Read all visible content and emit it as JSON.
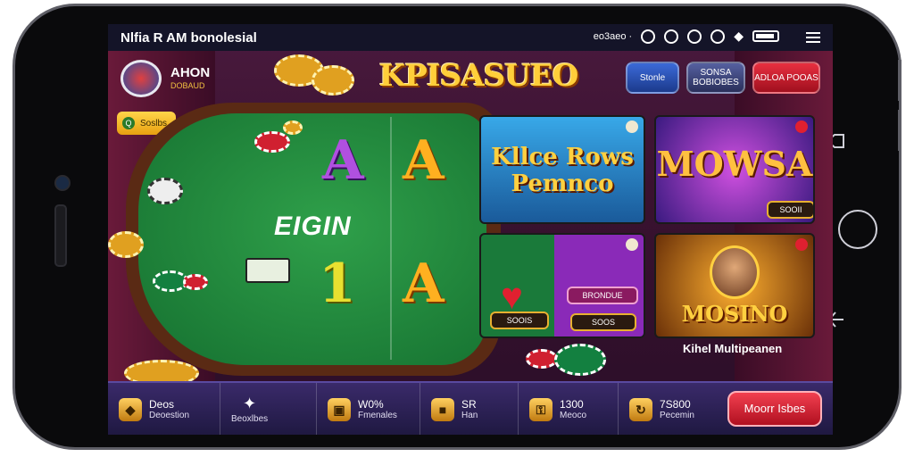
{
  "status": {
    "title": "Nlfia R AM bonolesial",
    "right_text": "eo3aeo ·",
    "icons": [
      "wifi-icon",
      "location-icon",
      "shield-icon",
      "lock-icon",
      "dice-icon",
      "battery-icon",
      "menu-icon"
    ]
  },
  "header": {
    "logo_text": "AHON",
    "logo_sub": "DOBAUD",
    "game_title": "KPISASUEO",
    "buttons": [
      "Stonle",
      "SONSA BOBIOBES",
      "ADLOA POOAS"
    ]
  },
  "pill": {
    "label": "Soslbs"
  },
  "table": {
    "label": "EIGIN",
    "cards": [
      "A",
      "A",
      "1",
      "A"
    ]
  },
  "tiles": [
    {
      "title": "Kllce Rows Pemnco",
      "badge": ""
    },
    {
      "title": "MOWSA",
      "button": "SOOII",
      "badge": ""
    },
    {
      "button": "SOOIS",
      "button2": "SOOS",
      "sub": "BRONDUE",
      "badge": ""
    },
    {
      "title": "MOSINO",
      "badge": ""
    }
  ],
  "tile_caption": "Kihel Multipeanen",
  "bottom": {
    "items": [
      {
        "icon": "diamond-icon",
        "value": "Deos",
        "sub": "Deoestion"
      },
      {
        "icon": "gift-icon",
        "value": "",
        "sub": "Beoxlbes"
      },
      {
        "icon": "bag-icon",
        "value": "W0%",
        "sub": "Fmenales"
      },
      {
        "icon": "box-icon",
        "value": "SR",
        "sub": "Han"
      },
      {
        "icon": "key-icon",
        "value": "1300",
        "sub": "Meoco"
      },
      {
        "icon": "refresh-icon",
        "value": "7S800",
        "sub": "Pecemin"
      }
    ],
    "cta": "Moorr Isbes"
  },
  "colors": {
    "accent_gold": "#ffce3a",
    "table_green": "#157030",
    "cta_red": "#e02030",
    "bottom_bar": "#2a2250"
  }
}
